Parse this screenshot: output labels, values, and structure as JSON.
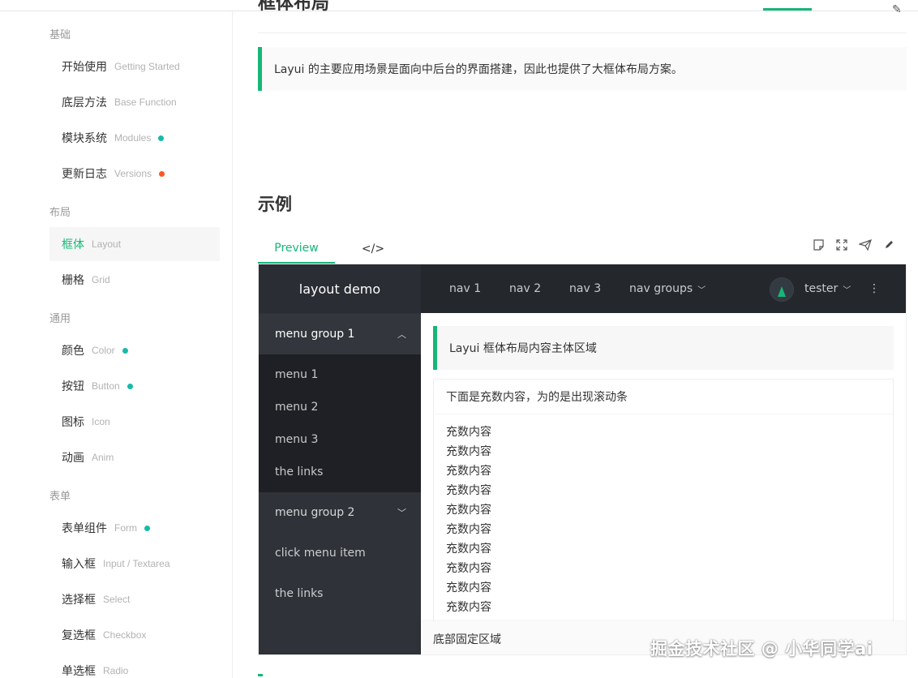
{
  "doc_title_partial": "框体布局",
  "sidebar": {
    "groups": [
      {
        "label": "基础"
      },
      {
        "label": "布局"
      },
      {
        "label": "通用"
      },
      {
        "label": "表单"
      }
    ],
    "items": [
      {
        "cn": "开始使用",
        "en": "Getting Started",
        "dot": ""
      },
      {
        "cn": "底层方法",
        "en": "Base Function",
        "dot": ""
      },
      {
        "cn": "模块系统",
        "en": "Modules",
        "dot": "#16baaa"
      },
      {
        "cn": "更新日志",
        "en": "Versions",
        "dot": "#ff5722"
      },
      {
        "cn": "框体",
        "en": "Layout",
        "dot": "",
        "active": true
      },
      {
        "cn": "栅格",
        "en": "Grid",
        "dot": ""
      },
      {
        "cn": "颜色",
        "en": "Color",
        "dot": "#16baaa"
      },
      {
        "cn": "按钮",
        "en": "Button",
        "dot": "#16baaa"
      },
      {
        "cn": "图标",
        "en": "Icon",
        "dot": ""
      },
      {
        "cn": "动画",
        "en": "Anim",
        "dot": ""
      },
      {
        "cn": "表单组件",
        "en": "Form",
        "dot": "#16baaa"
      },
      {
        "cn": "输入框",
        "en": "Input / Textarea",
        "dot": ""
      },
      {
        "cn": "选择框",
        "en": "Select",
        "dot": ""
      },
      {
        "cn": "复选框",
        "en": "Checkbox",
        "dot": ""
      },
      {
        "cn": "单选框",
        "en": "Radio",
        "dot": ""
      }
    ]
  },
  "intro_quote": "Layui 的主要应用场景是面向中后台的界面搭建，因此也提供了大框体布局方案。",
  "section_title": "示例",
  "tabs": {
    "preview": "Preview",
    "code": "</>"
  },
  "tool_icons": [
    "note-icon",
    "fullscreen-icon",
    "send-icon",
    "edit-icon"
  ],
  "demo": {
    "logo": "layout demo",
    "nav": [
      "nav 1",
      "nav 2",
      "nav 3",
      "nav groups"
    ],
    "user": "tester",
    "menu_group_1": "menu group 1",
    "menu_items": [
      "menu 1",
      "menu 2",
      "menu 3",
      "the links"
    ],
    "menu_group_2": "menu group 2",
    "menu_click": "click menu item",
    "menu_links": "the links",
    "body_quote": "Layui 框体布局内容主体区域",
    "card_header": "下面是充数内容，为的是出现滚动条",
    "fill_text": "充数内容",
    "fill_count": 10,
    "footer": "底部固定区域"
  },
  "watermark": "掘金技术社区 @ 小华同学ai",
  "colors": {
    "accent": "#16b777",
    "dot_teal": "#16baaa",
    "dot_orange": "#ff5722",
    "dark_side": "#2f3238",
    "dark_header": "#24272c"
  }
}
